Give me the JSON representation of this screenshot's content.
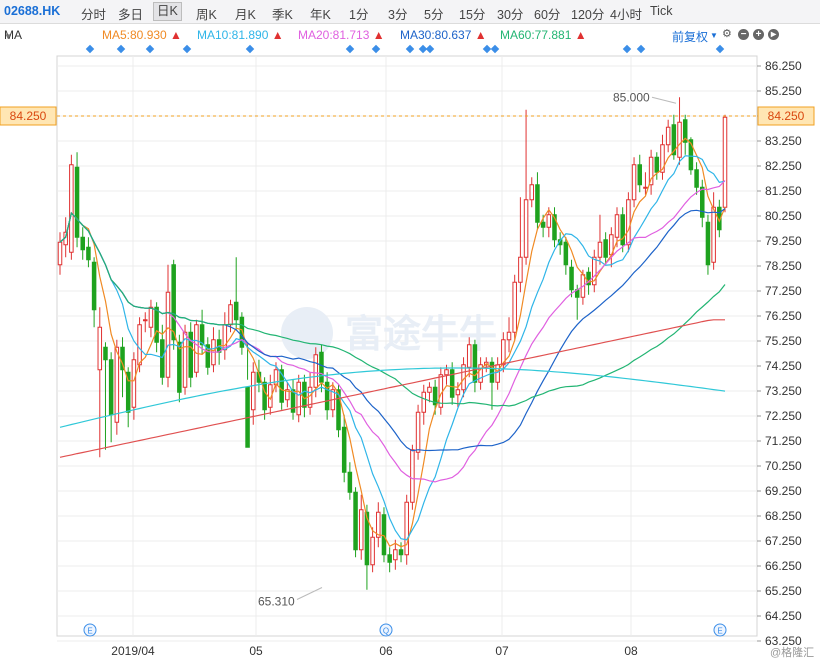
{
  "toolbar": {
    "ticker": "02688.HK",
    "tabs": [
      "分时",
      "多日",
      "日K",
      "周K",
      "月K",
      "季K",
      "年K",
      "1分",
      "3分",
      "5分",
      "15分",
      "30分",
      "60分",
      "120分",
      "4小时",
      "Tick"
    ],
    "active_tab": "日K"
  },
  "indicator_bar": {
    "label": "MA",
    "items": [
      {
        "text": "MA5:80.930",
        "color": "#f08a24"
      },
      {
        "text": "MA10:81.890",
        "color": "#2fb5e8"
      },
      {
        "text": "MA20:81.713",
        "color": "#e060e0"
      },
      {
        "text": "MA30:80.637",
        "color": "#1d63c9"
      },
      {
        "text": "MA60:77.881",
        "color": "#22b573"
      }
    ],
    "adjust": "前复权",
    "icons": [
      "dropdown-icon",
      "settings-icon",
      "minus-icon",
      "plus-icon",
      "play-icon"
    ]
  },
  "watermark": "富途牛牛",
  "credit": "格隆汇",
  "chart_data": {
    "type": "candlestick",
    "x_labels": [
      "2019/04",
      "05",
      "06",
      "07",
      "08"
    ],
    "y_ticks": [
      "86.250",
      "85.250",
      "84.250",
      "83.250",
      "82.250",
      "81.250",
      "80.250",
      "79.250",
      "78.250",
      "77.250",
      "76.250",
      "75.250",
      "74.250",
      "73.250",
      "72.250",
      "71.250",
      "70.250",
      "69.250",
      "68.250",
      "67.250",
      "66.250",
      "65.250",
      "64.250",
      "63.250"
    ],
    "ylim": [
      63.25,
      86.25
    ],
    "current_price": "84.250",
    "annotations": {
      "high": "85.000",
      "low": "65.310"
    },
    "event_markers": [
      "E",
      "Q",
      "E"
    ],
    "up_color": "#e03131",
    "down_color": "#1ea21e",
    "candles": [
      [
        78.3,
        79.2,
        77.9,
        79.6
      ],
      [
        79.1,
        79.6,
        78.6,
        80.2
      ],
      [
        78.8,
        82.3,
        78.5,
        82.7
      ],
      [
        82.2,
        79.4,
        79.0,
        82.8
      ],
      [
        79.4,
        78.9,
        78.5,
        79.8
      ],
      [
        79.0,
        78.5,
        78.2,
        79.4
      ],
      [
        78.4,
        76.5,
        75.8,
        78.6
      ],
      [
        74.1,
        75.8,
        70.6,
        76.6
      ],
      [
        75.0,
        74.5,
        70.9,
        75.2
      ],
      [
        74.5,
        72.3,
        71.2,
        74.8
      ],
      [
        72.0,
        75.0,
        71.5,
        75.3
      ],
      [
        75.0,
        74.1,
        73.0,
        75.4
      ],
      [
        74.0,
        72.4,
        71.8,
        74.2
      ],
      [
        72.6,
        74.5,
        72.1,
        74.8
      ],
      [
        74.3,
        75.9,
        74.0,
        76.2
      ],
      [
        76.1,
        76.1,
        75.6,
        76.4
      ],
      [
        75.8,
        76.6,
        75.4,
        76.9
      ],
      [
        76.6,
        75.2,
        74.8,
        76.8
      ],
      [
        75.3,
        73.8,
        73.5,
        75.9
      ],
      [
        73.8,
        77.2,
        73.4,
        78.3
      ],
      [
        78.3,
        75.3,
        74.9,
        78.5
      ],
      [
        75.2,
        73.2,
        72.8,
        75.5
      ],
      [
        73.4,
        75.6,
        73.1,
        75.9
      ],
      [
        75.6,
        73.8,
        73.4,
        76.0
      ],
      [
        74.0,
        75.9,
        73.8,
        76.1
      ],
      [
        75.9,
        75.1,
        74.7,
        76.5
      ],
      [
        75.1,
        74.2,
        73.9,
        75.4
      ],
      [
        74.3,
        75.3,
        74.0,
        75.8
      ],
      [
        75.3,
        74.8,
        74.3,
        75.7
      ],
      [
        74.9,
        75.9,
        74.5,
        76.4
      ],
      [
        75.9,
        76.7,
        75.6,
        76.9
      ],
      [
        76.8,
        76.1,
        75.7,
        78.6
      ],
      [
        76.2,
        75.0,
        74.7,
        76.4
      ],
      [
        73.4,
        71.0,
        73.7,
        75.2
      ],
      [
        72.5,
        74.0,
        71.9,
        74.4
      ],
      [
        74.0,
        73.6,
        73.2,
        74.5
      ],
      [
        73.6,
        72.5,
        72.1,
        73.8
      ],
      [
        72.6,
        73.5,
        72.3,
        73.9
      ],
      [
        73.5,
        74.1,
        73.2,
        74.4
      ],
      [
        74.1,
        72.8,
        72.5,
        74.3
      ],
      [
        72.9,
        73.3,
        72.6,
        73.6
      ],
      [
        73.3,
        72.4,
        72.1,
        73.7
      ],
      [
        72.3,
        73.6,
        72.0,
        73.9
      ],
      [
        73.6,
        72.6,
        72.2,
        73.9
      ],
      [
        72.6,
        73.4,
        72.3,
        74.0
      ],
      [
        73.4,
        74.7,
        73.0,
        75.0
      ],
      [
        74.8,
        73.6,
        73.2,
        75.1
      ],
      [
        73.6,
        72.5,
        72.1,
        74.0
      ],
      [
        72.5,
        73.3,
        72.2,
        73.6
      ],
      [
        73.3,
        71.7,
        71.4,
        73.5
      ],
      [
        71.8,
        70.0,
        69.6,
        72.3
      ],
      [
        70.0,
        69.2,
        68.9,
        70.4
      ],
      [
        69.2,
        66.9,
        66.6,
        69.4
      ],
      [
        66.9,
        68.5,
        66.5,
        69.1
      ],
      [
        68.4,
        66.3,
        65.3,
        68.7
      ],
      [
        66.3,
        67.4,
        66.0,
        67.8
      ],
      [
        67.4,
        68.4,
        67.0,
        68.8
      ],
      [
        68.3,
        66.7,
        66.4,
        68.6
      ],
      [
        66.7,
        66.4,
        66.0,
        67.0
      ],
      [
        66.5,
        66.9,
        66.1,
        67.3
      ],
      [
        66.9,
        66.7,
        66.4,
        67.2
      ],
      [
        66.7,
        68.8,
        66.3,
        69.1
      ],
      [
        68.8,
        70.9,
        68.5,
        71.1
      ],
      [
        70.8,
        72.4,
        70.5,
        72.7
      ],
      [
        72.4,
        73.2,
        71.9,
        73.5
      ],
      [
        73.2,
        73.4,
        72.8,
        73.6
      ],
      [
        73.4,
        72.7,
        72.3,
        73.7
      ],
      [
        72.6,
        73.9,
        72.3,
        74.2
      ],
      [
        73.9,
        74.1,
        73.5,
        74.3
      ],
      [
        74.1,
        73.0,
        72.7,
        74.4
      ],
      [
        73.1,
        73.3,
        72.6,
        73.6
      ],
      [
        73.3,
        74.3,
        73.0,
        74.6
      ],
      [
        74.2,
        75.1,
        73.8,
        75.4
      ],
      [
        75.1,
        73.6,
        73.2,
        75.3
      ],
      [
        73.6,
        74.3,
        73.3,
        74.6
      ],
      [
        74.3,
        74.4,
        74.0,
        74.6
      ],
      [
        74.4,
        73.6,
        72.5,
        74.6
      ],
      [
        73.6,
        74.3,
        73.3,
        74.6
      ],
      [
        74.3,
        75.3,
        74.0,
        75.6
      ],
      [
        75.3,
        75.6,
        74.8,
        76.2
      ],
      [
        75.6,
        77.6,
        75.3,
        77.9
      ],
      [
        77.6,
        78.6,
        77.2,
        81.0
      ],
      [
        78.6,
        80.9,
        78.3,
        84.5
      ],
      [
        80.9,
        81.5,
        80.6,
        81.8
      ],
      [
        81.5,
        80.0,
        79.7,
        82.0
      ],
      [
        80.0,
        79.8,
        79.4,
        80.3
      ],
      [
        79.8,
        80.3,
        79.4,
        80.6
      ],
      [
        80.3,
        79.3,
        79.0,
        80.6
      ],
      [
        79.3,
        79.1,
        78.7,
        79.6
      ],
      [
        79.2,
        78.3,
        77.9,
        79.4
      ],
      [
        78.2,
        77.3,
        77.0,
        78.5
      ],
      [
        77.3,
        77.0,
        76.1,
        77.5
      ],
      [
        77.0,
        77.9,
        76.7,
        78.1
      ],
      [
        78.0,
        77.5,
        77.1,
        78.2
      ],
      [
        77.5,
        78.6,
        77.2,
        78.9
      ],
      [
        78.6,
        79.2,
        78.3,
        80.3
      ],
      [
        79.3,
        78.6,
        78.3,
        79.6
      ],
      [
        78.7,
        79.5,
        78.2,
        79.8
      ],
      [
        79.4,
        80.3,
        79.0,
        80.6
      ],
      [
        80.3,
        79.1,
        78.8,
        80.6
      ],
      [
        79.1,
        80.9,
        78.8,
        81.2
      ],
      [
        80.9,
        82.3,
        80.6,
        82.6
      ],
      [
        82.3,
        81.5,
        81.2,
        82.7
      ],
      [
        81.4,
        81.4,
        81.1,
        82.0
      ],
      [
        81.5,
        82.6,
        81.1,
        82.9
      ],
      [
        82.6,
        82.0,
        81.7,
        82.8
      ],
      [
        82.0,
        83.1,
        81.7,
        83.5
      ],
      [
        83.1,
        83.8,
        82.8,
        84.1
      ],
      [
        83.9,
        82.7,
        82.5,
        84.3
      ],
      [
        82.6,
        84.0,
        82.3,
        85.0
      ],
      [
        84.1,
        83.2,
        82.7,
        84.3
      ],
      [
        83.3,
        82.1,
        81.9,
        83.4
      ],
      [
        82.1,
        81.4,
        81.1,
        82.4
      ],
      [
        81.4,
        80.2,
        79.8,
        81.7
      ],
      [
        80.0,
        78.3,
        77.9,
        80.3
      ],
      [
        78.4,
        80.6,
        78.1,
        81.2
      ],
      [
        80.6,
        79.7,
        79.4,
        80.9
      ],
      [
        80.6,
        84.2,
        80.4,
        84.3
      ]
    ]
  }
}
